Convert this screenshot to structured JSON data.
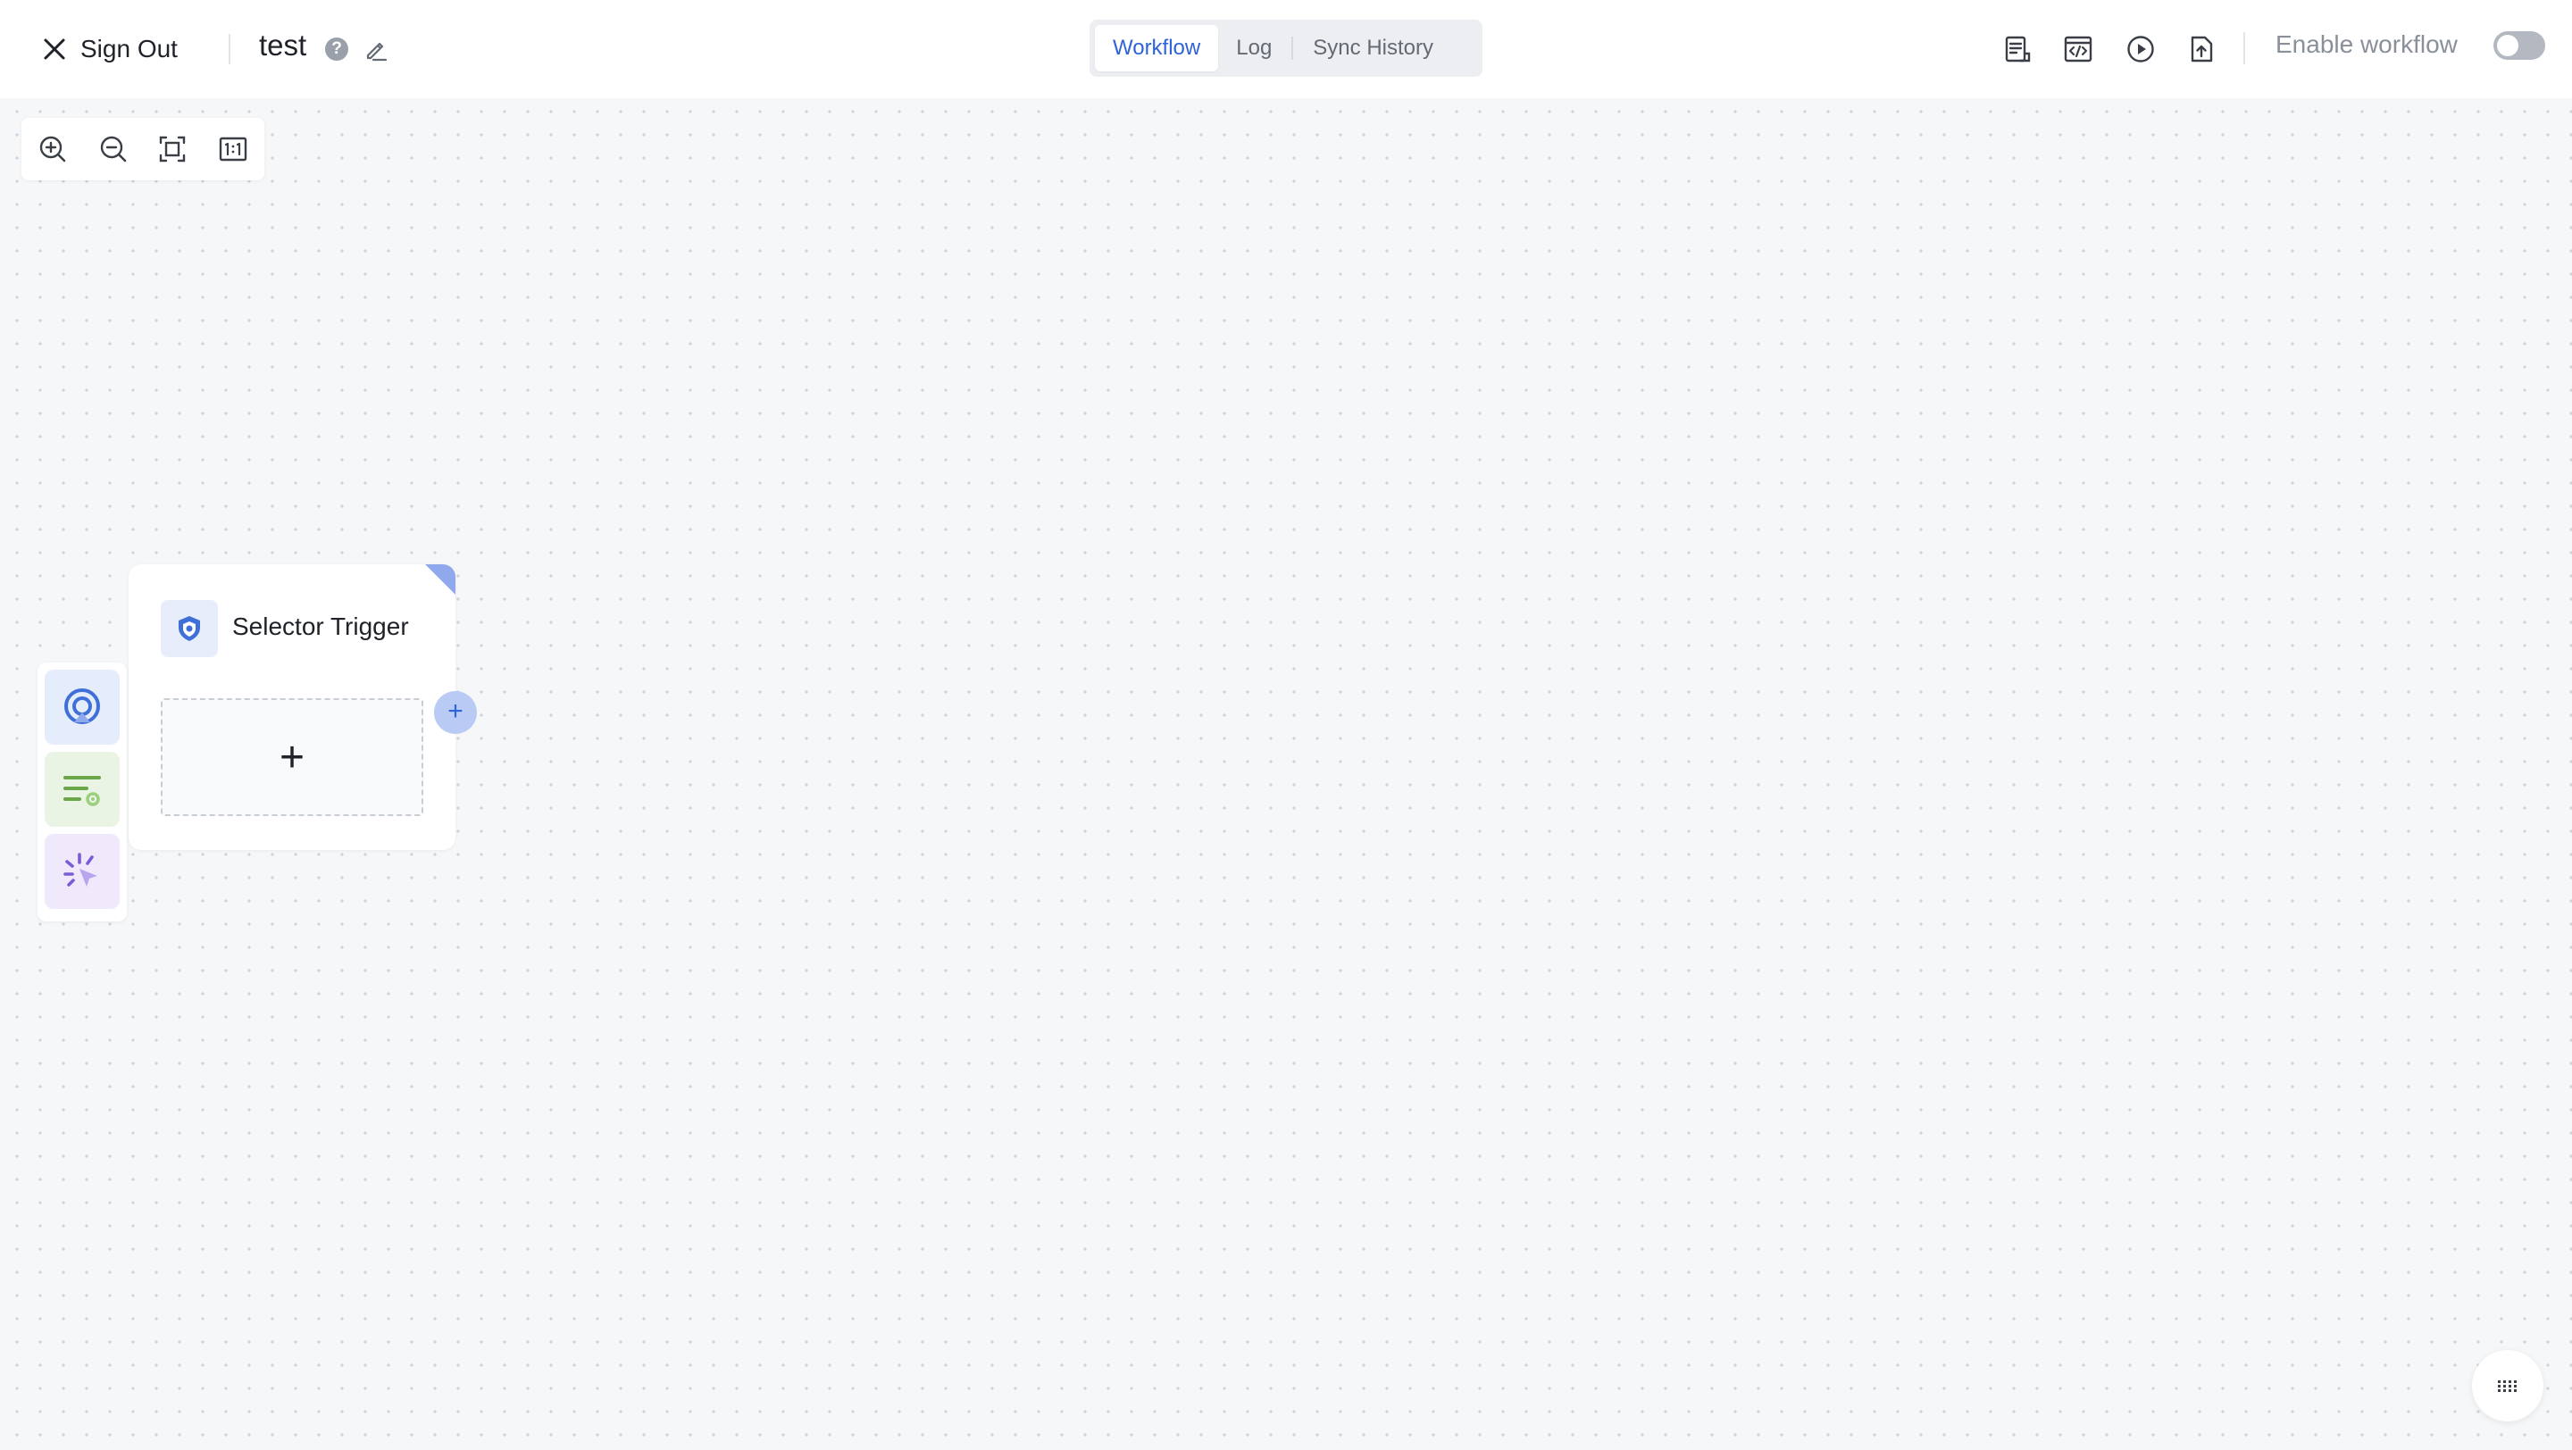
{
  "header": {
    "signout_label": "Sign Out",
    "workflow_name": "test",
    "help_glyph": "?",
    "tabs": [
      {
        "label": "Workflow",
        "active": true
      },
      {
        "label": "Log",
        "active": false
      },
      {
        "label": "Sync History",
        "active": false
      }
    ],
    "toolbar_icons": [
      "document-icon",
      "code-icon",
      "play-icon",
      "upload-file-icon"
    ],
    "enable_label": "Enable workflow",
    "enable_on": false
  },
  "canvas": {
    "zoom_controls": [
      "zoom-in-icon",
      "zoom-out-icon",
      "fit-screen-icon",
      "actual-size-icon"
    ],
    "palette": [
      {
        "icon": "trigger-icon",
        "color": "#3f6fd8",
        "bg": "#e5ecfb"
      },
      {
        "icon": "list-settings-icon",
        "color": "#6aa64a",
        "bg": "#eaf4e4"
      },
      {
        "icon": "click-action-icon",
        "color": "#7b5bd6",
        "bg": "#efe9fb"
      }
    ],
    "node": {
      "title": "Selector Trigger",
      "add_glyph": "+",
      "connector_glyph": "+"
    }
  },
  "colors": {
    "accent": "#2f63d8",
    "node_corner": "#8fa9ec"
  }
}
